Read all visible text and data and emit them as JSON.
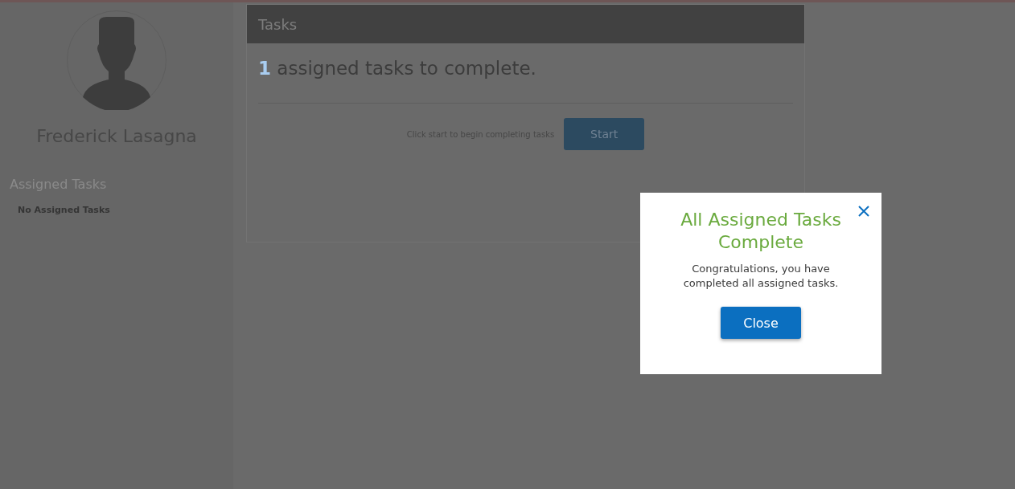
{
  "sidebar": {
    "user_name": "Frederick Lasagna",
    "section_title": "Assigned Tasks",
    "empty_message": "No Assigned Tasks"
  },
  "panel": {
    "title": "Tasks",
    "count": "1",
    "summary": "assigned tasks to complete.",
    "hint": "Click start to begin completing tasks",
    "start_button": "Start"
  },
  "dialog": {
    "title": "All Assigned Tasks Complete",
    "message": "Congratulations, you have completed all assigned tasks.",
    "close_button": "Close"
  }
}
